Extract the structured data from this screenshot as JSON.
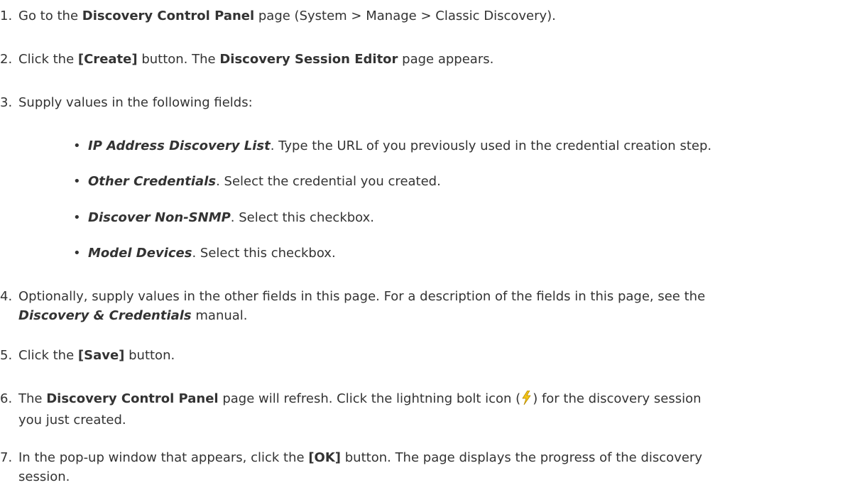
{
  "steps": [
    {
      "num": "1.",
      "a": "Go to the ",
      "b": "Discovery Control Panel",
      "c": " page (System > Manage > Classic Discovery)."
    },
    {
      "num": "2.",
      "a": "Click the ",
      "b": "[Create]",
      "c": " button. The ",
      "d": "Discovery Session Editor",
      "e": " page appears."
    },
    {
      "num": "3.",
      "a": "Supply values in the following fields:"
    },
    {
      "num": "4.",
      "a": "Optionally, supply values in the other fields in this page. For a description of the fields in this page, see the",
      "b": "Discovery & Credentials",
      "c": " manual."
    },
    {
      "num": "5.",
      "a": "Click the ",
      "b": "[Save]",
      "c": " button."
    },
    {
      "num": "6.",
      "a": "The ",
      "b": "Discovery Control Panel",
      "c": " page will refresh. Click the lightning bolt icon (",
      "d": ") for the discovery session",
      "e": "you just created."
    },
    {
      "num": "7.",
      "a": "In the pop-up window that appears, click the ",
      "b": "[OK]",
      "c": " button. The page displays the progress of the discovery",
      "d": "session."
    }
  ],
  "fields": [
    {
      "name": "IP Address Discovery List",
      "desc": ". Type the URL of you previously used in the credential creation step."
    },
    {
      "name": "Other Credentials",
      "desc": ". Select the credential you created."
    },
    {
      "name": "Discover Non-SNMP",
      "desc": ". Select this checkbox."
    },
    {
      "name": "Model Devices",
      "desc": ". Select this checkbox."
    }
  ],
  "bullet_char": "•",
  "icon": "lightning-bolt-icon",
  "colors": {
    "text": "#333333",
    "bolt_fill": "#f5c518",
    "bolt_stroke": "#b58a00"
  }
}
